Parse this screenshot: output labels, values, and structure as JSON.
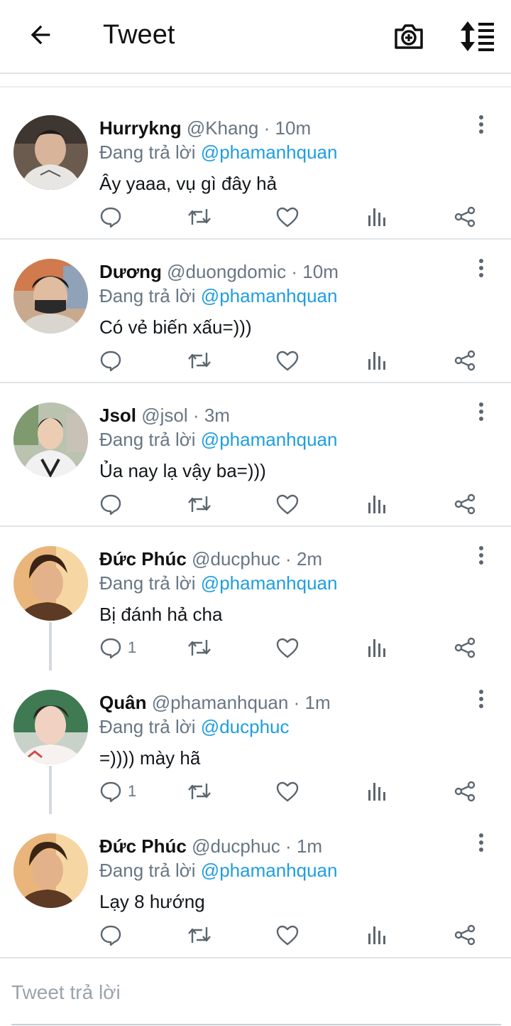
{
  "header": {
    "title": "Tweet",
    "back_icon": "arrow-left-icon",
    "camera_icon": "camera-plus-icon",
    "sort_icon": "sort-list-icon"
  },
  "colors": {
    "mention": "#1e9ee1",
    "secondary_text": "#687684",
    "divider": "#e1e4e7"
  },
  "tweets": [
    {
      "name": "Hurrykng",
      "handle": "@Khang",
      "dot": "·",
      "time": "10m",
      "reply_prefix": "Đang trả lời",
      "reply_to": "@phamanhquan",
      "text": "Ây yaaa, vụ gì đây hả",
      "reply_count": ""
    },
    {
      "name": "Dương",
      "handle": "@duongdomic",
      "dot": "·",
      "time": "10m",
      "reply_prefix": "Đang trả lời",
      "reply_to": "@phamanhquan",
      "text": "Có vẻ biến xấu=)))",
      "reply_count": ""
    },
    {
      "name": "Jsol",
      "handle": "@jsol",
      "dot": "·",
      "time": "3m",
      "reply_prefix": "Đang trả lời",
      "reply_to": "@phamanhquan",
      "text": "Ủa nay lạ vậy ba=)))",
      "reply_count": ""
    },
    {
      "name": "Đức Phúc",
      "handle": "@ducphuc",
      "dot": "·",
      "time": "2m",
      "reply_prefix": "Đang trả lời",
      "reply_to": "@phamanhquan",
      "text": "Bị đánh hả cha",
      "reply_count": "1"
    },
    {
      "name": "Quân",
      "handle": "@phamanhquan",
      "dot": "·",
      "time": "1m",
      "reply_prefix": "Đang trả lời",
      "reply_to": "@ducphuc",
      "text": "=)))) mày hã",
      "reply_count": "1"
    },
    {
      "name": "Đức Phúc",
      "handle": "@ducphuc",
      "dot": "·",
      "time": "1m",
      "reply_prefix": "Đang trả lời",
      "reply_to": "@phamanhquan",
      "text": "Lạy 8 hướng",
      "reply_count": ""
    }
  ],
  "composer": {
    "placeholder": "Tweet trả lời"
  }
}
